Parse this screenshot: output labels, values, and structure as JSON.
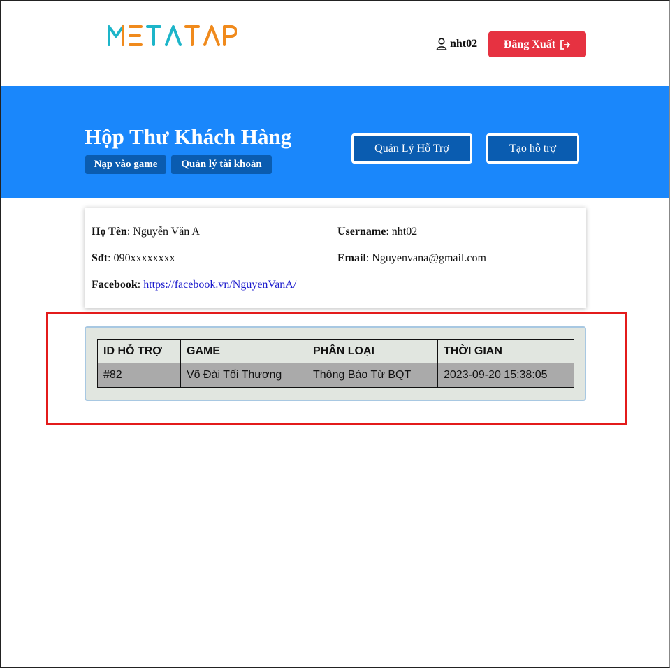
{
  "header": {
    "logo_text": "METATAP",
    "username": "nht02",
    "logout_label": "Đăng Xuất"
  },
  "banner": {
    "title": "Hộp Thư Khách Hàng",
    "tabs": [
      "Nạp vào game",
      "Quản lý tài khoản"
    ],
    "buttons": [
      "Quản Lý Hỗ Trợ",
      "Tạo hỗ trợ"
    ]
  },
  "profile": {
    "name_label": "Họ Tên",
    "name_value": "Nguyễn Văn A",
    "username_label": "Username",
    "username_value": "nht02",
    "phone_label": "Sđt",
    "phone_value": "090xxxxxxxx",
    "email_label": "Email",
    "email_value": "Nguyenvana@gmail.com",
    "facebook_label": "Facebook",
    "facebook_value": "https://facebook.vn/NguyenVanA/"
  },
  "table": {
    "headers": [
      "ID HỖ TRỢ",
      "GAME",
      "PHÂN LOẠI",
      "THỜI GIAN"
    ],
    "rows": [
      [
        "#82",
        "Võ Đài Tối Thượng",
        "Thông Báo Từ BQT",
        "2023-09-20 15:38:05"
      ]
    ]
  },
  "colors": {
    "banner": "#1a87fb",
    "dark_button": "#0a5cb0",
    "logout": "#e63241",
    "highlight": "#e31b1b"
  }
}
